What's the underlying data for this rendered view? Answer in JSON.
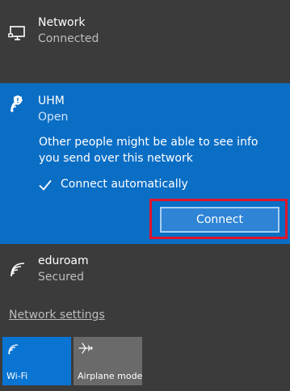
{
  "networks": {
    "network": {
      "name": "Network",
      "status": "Connected",
      "icon": "ethernet-monitor-icon"
    },
    "uhm": {
      "name": "UHM",
      "status": "Open",
      "icon": "wifi-shield-warning-icon",
      "warning": "Other people might be able to see info you send over this network",
      "connect_auto_label": "Connect automatically",
      "connect_auto_checked": true,
      "connect_label": "Connect"
    },
    "eduroam": {
      "name": "eduroam",
      "status": "Secured",
      "icon": "wifi-icon"
    }
  },
  "settings_link": "Network settings",
  "tiles": {
    "wifi": {
      "label": "Wi-Fi",
      "icon": "wifi-icon",
      "active": true
    },
    "airplane": {
      "label": "Airplane mode",
      "icon": "airplane-icon",
      "active": false
    }
  },
  "colors": {
    "panel_bg": "#3b3b3b",
    "selected_bg": "#0b6ec5",
    "highlight_border": "#e0142b",
    "tile_active": "#0a74d3",
    "tile_inactive": "#6a6a6a"
  }
}
